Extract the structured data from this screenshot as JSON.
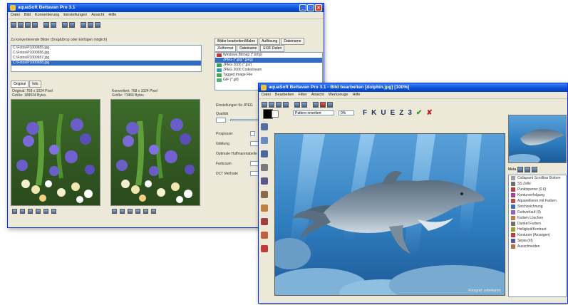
{
  "window1": {
    "title": "aquaSoft Bettavan Pro 3.1",
    "menu": [
      "Datei",
      "Bild",
      "Konvertierung",
      "Einstellungen",
      "Ansicht",
      "Hilfe"
    ],
    "file_list_label": "Zu konvertierende Bilder (Drag&Drop oder Einfügen möglich)",
    "files": [
      "C:\\Fotos\\P1000655.jpg",
      "C:\\Fotos\\P1000656.jpg",
      "C:\\Fotos\\P1000657.jpg",
      "C:\\Fotos\\P1000658.jpg"
    ],
    "selected_file_index": 3,
    "preview_tabs": [
      "Original",
      "Info"
    ],
    "original_info": "Original: 768 x 1024 Pixel",
    "original_size": "Größe: 188924 Bytes",
    "converted_info": "Konvertiert: 768 x 1024 Pixel",
    "converted_size": "Größe: 71966 Bytes",
    "right_tabs_row1": [
      "Bilder bearbeiten/Makro",
      "Auflösung",
      "Dateiname"
    ],
    "right_tabs_row2": [
      "Zielformat",
      "Dateiname",
      "EXIF Daten"
    ],
    "formats": [
      {
        "label": "Windows Bitmap (*.bmp)",
        "color": "#c03a3a"
      },
      {
        "label": "JPEG (*.jpg;*.jpeg)",
        "color": "#3a6fc0"
      },
      {
        "label": "JPEG 2000 (*.jp2)",
        "color": "#3aa55a"
      },
      {
        "label": "JPEG 2000 Codestream",
        "color": "#3a9aa5"
      },
      {
        "label": "Tagged Image File",
        "color": "#4aaa4a"
      },
      {
        "label": "GIF (*.gif)",
        "color": "#58b078"
      }
    ],
    "selected_format_index": 1,
    "settings_title": "Einstellungen für JPEG",
    "settings_labels": [
      "Qualität",
      "Progressiv",
      "Glättung",
      "Optimale Huffmanntabelle",
      "Farbraum",
      "DCT Methode"
    ]
  },
  "window2": {
    "title": "aquaSoft Bettavan Pro 3.1 - Bild bearbeiten [dolphin.jpg] [100%]",
    "menu": [
      "Datei",
      "Bearbeiten",
      "Filter",
      "Ansicht",
      "Werkzeuge",
      "Hilfe"
    ],
    "fill_mode": "Pattern invertiert",
    "zoom": "0%",
    "format_buttons": [
      "F",
      "K",
      "U",
      "E",
      "Z",
      "3",
      "✔",
      "✘"
    ],
    "tree_header": "Meta",
    "tree_items": [
      {
        "label": "Collapsed Scrollbar Bottom",
        "color": "#a0a0a0"
      },
      {
        "label": "SS Zelle",
        "color": "#707070"
      },
      {
        "label": "Punktsperrer (0.6)",
        "color": "#c03a3a"
      },
      {
        "label": "Konturverfolgung",
        "color": "#b03aa0"
      },
      {
        "label": "Aquarellieren mit Farben",
        "color": "#c04a3a"
      },
      {
        "label": "Strichzeichnung",
        "color": "#3a6fc0"
      },
      {
        "label": "Farbverlauf (II)",
        "color": "#a05ac0"
      },
      {
        "label": "Farben Löschen",
        "color": "#c07a3a"
      },
      {
        "label": "Dunkel Farben",
        "color": "#707070"
      },
      {
        "label": "Helligkeit/Kontrast",
        "color": "#a0a030"
      },
      {
        "label": "Konturen (Anzeigen)",
        "color": "#c03a3a"
      },
      {
        "label": "Sepia (III)",
        "color": "#5a5aa0"
      },
      {
        "label": "Ausschneiden",
        "color": "#c06a3a"
      }
    ],
    "image_caption": "Fotograf: unbekannt"
  }
}
